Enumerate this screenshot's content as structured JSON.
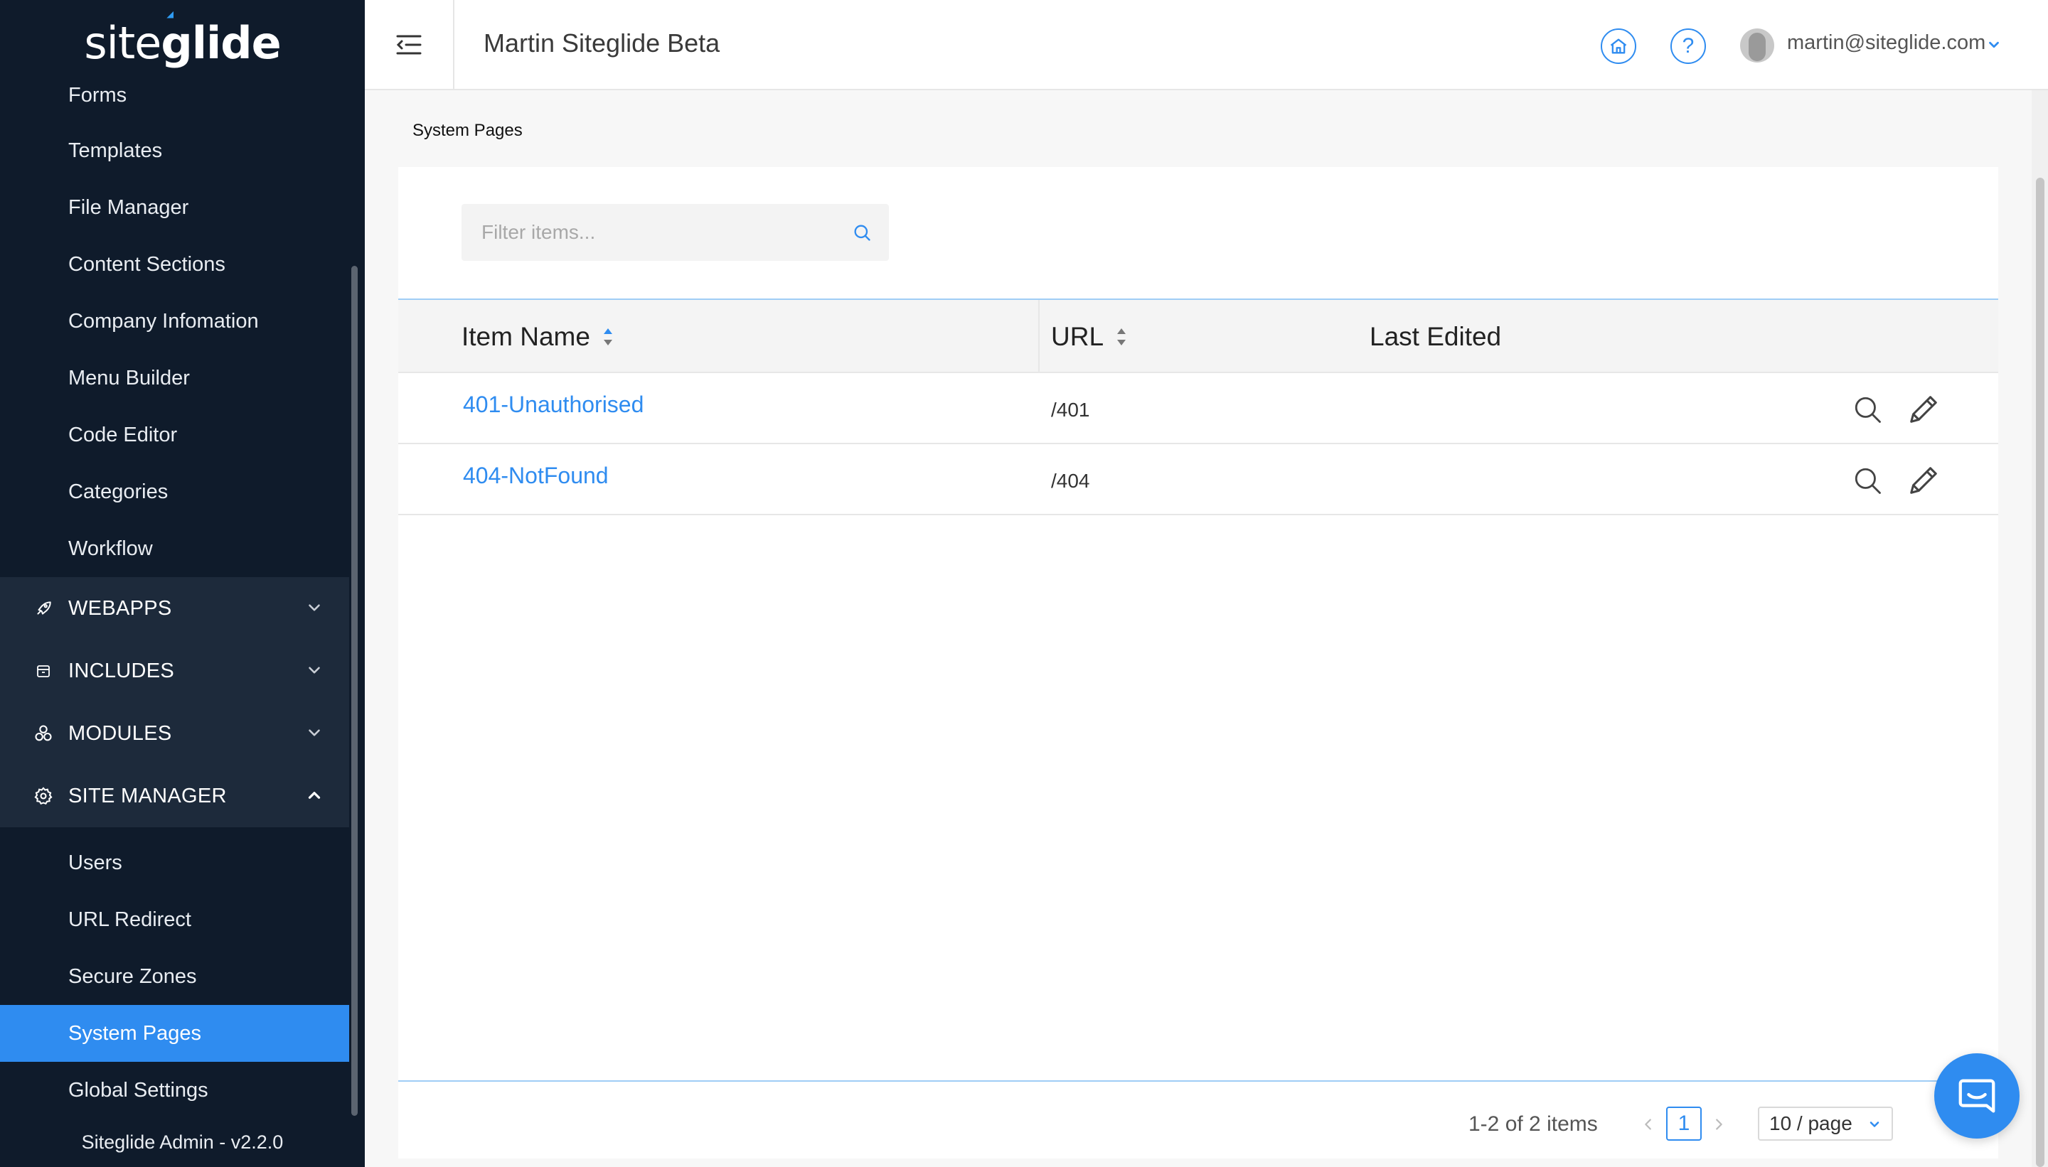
{
  "brand": {
    "logo_left": "site",
    "logo_right": "glide"
  },
  "sidebar": {
    "items_top": [
      {
        "label": "Forms"
      },
      {
        "label": "Templates"
      },
      {
        "label": "File Manager"
      },
      {
        "label": "Content Sections"
      },
      {
        "label": "Company Infomation"
      },
      {
        "label": "Menu Builder"
      },
      {
        "label": "Code Editor"
      },
      {
        "label": "Categories"
      },
      {
        "label": "Workflow"
      }
    ],
    "groups": [
      {
        "label": "WEBAPPS",
        "icon": "rocket-icon",
        "expanded": false
      },
      {
        "label": "INCLUDES",
        "icon": "box-icon",
        "expanded": false
      },
      {
        "label": "MODULES",
        "icon": "modules-icon",
        "expanded": false
      },
      {
        "label": "SITE MANAGER",
        "icon": "gear-icon",
        "expanded": true
      }
    ],
    "site_manager_items": [
      {
        "label": "Users"
      },
      {
        "label": "URL Redirect"
      },
      {
        "label": "Secure Zones"
      },
      {
        "label": "System Pages",
        "active": true
      },
      {
        "label": "Global Settings"
      }
    ],
    "footer": "Siteglide Admin - v2.2.0"
  },
  "header": {
    "site_title": "Martin Siteglide Beta",
    "help_symbol": "?",
    "user_email": "martin@siteglide.com"
  },
  "breadcrumb": "System Pages",
  "filter": {
    "placeholder": "Filter items...",
    "value": ""
  },
  "table": {
    "columns": [
      "Item Name",
      "URL",
      "Last Edited"
    ],
    "rows": [
      {
        "name": "401-Unauthorised",
        "url": "/401",
        "last_edited": ""
      },
      {
        "name": "404-NotFound",
        "url": "/404",
        "last_edited": ""
      }
    ]
  },
  "pagination": {
    "range_text": "1-2 of 2 items",
    "current_page": "1",
    "per_page": "10 / page"
  },
  "colors": {
    "accent": "#2f8cf0",
    "sidebar_bg": "#0f1b2b",
    "group_bg": "#1d2a3b"
  }
}
